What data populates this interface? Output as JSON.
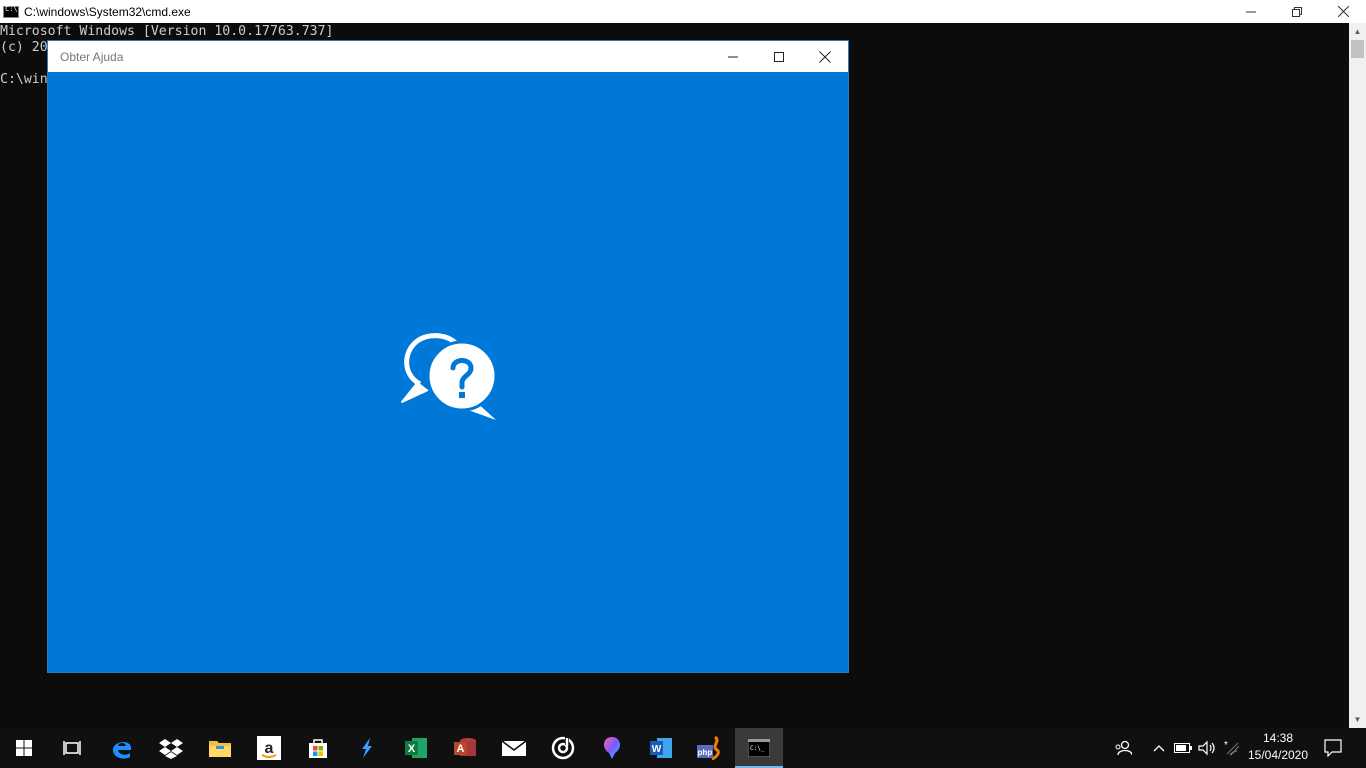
{
  "cmd": {
    "title": "C:\\windows\\System32\\cmd.exe",
    "lines": [
      "Microsoft Windows [Version 10.0.17763.737]",
      "(c) 20",
      "",
      "C:\\win"
    ]
  },
  "help_window": {
    "title": "Obter Ajuda"
  },
  "taskbar": {
    "apps": [
      {
        "name": "start",
        "icon": "windows-logo-icon"
      },
      {
        "name": "task-view",
        "icon": "task-view-icon"
      },
      {
        "name": "edge",
        "icon": "edge-icon"
      },
      {
        "name": "dropbox",
        "icon": "dropbox-icon"
      },
      {
        "name": "file-explorer",
        "icon": "folder-icon"
      },
      {
        "name": "amazon",
        "icon": "amazon-icon"
      },
      {
        "name": "store",
        "icon": "store-icon"
      },
      {
        "name": "visual-studio",
        "icon": "visual-studio-icon"
      },
      {
        "name": "excel",
        "icon": "excel-icon"
      },
      {
        "name": "access",
        "icon": "access-icon"
      },
      {
        "name": "mail",
        "icon": "mail-icon"
      },
      {
        "name": "groove",
        "icon": "groove-icon"
      },
      {
        "name": "paint-3d",
        "icon": "paint-3d-icon"
      },
      {
        "name": "word",
        "icon": "word-icon"
      },
      {
        "name": "php",
        "icon": "php-icon"
      },
      {
        "name": "cmd",
        "icon": "cmd-icon",
        "active": true
      }
    ],
    "clock": {
      "time": "14:38",
      "date": "15/04/2020"
    }
  },
  "colors": {
    "help_accent": "#0078d7",
    "cmd_background": "#0c0c0c",
    "taskbar": "#101010"
  }
}
